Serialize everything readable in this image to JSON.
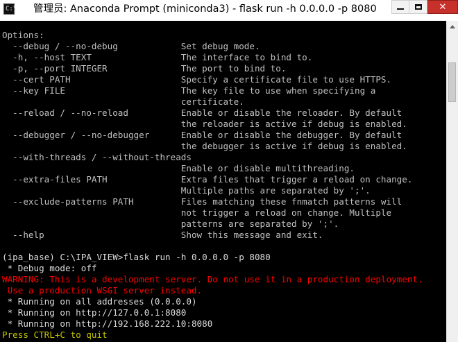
{
  "window": {
    "title": "管理员: Anaconda Prompt (miniconda3) - flask  run -h 0.0.0.0 -p 8080",
    "icon": "terminal-icon",
    "icon_glyph": "C:\\",
    "close_glyph": "✕",
    "close_color": "#c7302b"
  },
  "console": {
    "background": "#000000",
    "lines": [
      {
        "text": "Options:",
        "color": "default"
      },
      {
        "text": "  --debug / --no-debug            Set debug mode.",
        "color": "default"
      },
      {
        "text": "  -h, --host TEXT                 The interface to bind to.",
        "color": "default"
      },
      {
        "text": "  -p, --port INTEGER              The port to bind to.",
        "color": "default"
      },
      {
        "text": "  --cert PATH                     Specify a certificate file to use HTTPS.",
        "color": "default"
      },
      {
        "text": "  --key FILE                      The key file to use when specifying a",
        "color": "default"
      },
      {
        "text": "                                  certificate.",
        "color": "default"
      },
      {
        "text": "  --reload / --no-reload          Enable or disable the reloader. By default",
        "color": "default"
      },
      {
        "text": "                                  the reloader is active if debug is enabled.",
        "color": "default"
      },
      {
        "text": "  --debugger / --no-debugger      Enable or disable the debugger. By default",
        "color": "default"
      },
      {
        "text": "                                  the debugger is active if debug is enabled.",
        "color": "default"
      },
      {
        "text": "  --with-threads / --without-threads",
        "color": "default"
      },
      {
        "text": "                                  Enable or disable multithreading.",
        "color": "default"
      },
      {
        "text": "  --extra-files PATH              Extra files that trigger a reload on change.",
        "color": "default"
      },
      {
        "text": "                                  Multiple paths are separated by ';'.",
        "color": "default"
      },
      {
        "text": "  --exclude-patterns PATH         Files matching these fnmatch patterns will",
        "color": "default"
      },
      {
        "text": "                                  not trigger a reload on change. Multiple",
        "color": "default"
      },
      {
        "text": "                                  patterns are separated by ';'.",
        "color": "default"
      },
      {
        "text": "  --help                          Show this message and exit.",
        "color": "default"
      },
      {
        "text": "",
        "color": "default"
      },
      {
        "text": "(ipa_base) C:\\IPA_VIEW>flask run -h 0.0.0.0 -p 8080",
        "color": "white"
      },
      {
        "text": " * Debug mode: off",
        "color": "white"
      },
      {
        "text": "WARNING: This is a development server. Do not use it in a production deployment.",
        "color": "red"
      },
      {
        "text": " Use a production WSGI server instead.",
        "color": "red"
      },
      {
        "text": " * Running on all addresses (0.0.0.0)",
        "color": "white"
      },
      {
        "text": " * Running on http://127.0.0.1:8080",
        "color": "white"
      },
      {
        "text": " * Running on http://192.168.222.10:8080",
        "color": "white"
      },
      {
        "text": "Press CTRL+C to quit",
        "color": "yellow"
      }
    ]
  },
  "colors": {
    "default": "#c0c0c0",
    "white": "#dcdcdc",
    "red": "#ff0000",
    "yellow": "#c3c300"
  }
}
